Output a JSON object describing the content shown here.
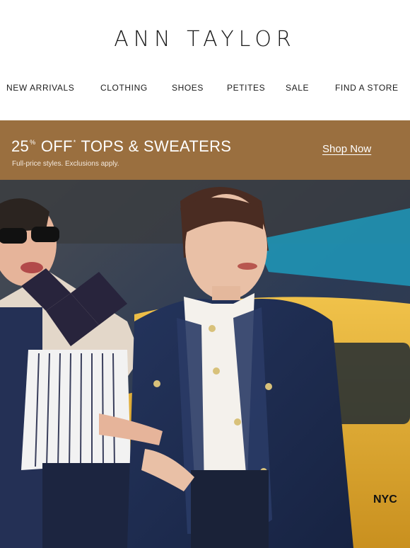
{
  "brand": {
    "name": "ANN TAYLOR"
  },
  "nav": {
    "items": [
      {
        "label": "NEW ARRIVALS"
      },
      {
        "label": "CLOTHING"
      },
      {
        "label": "SHOES"
      },
      {
        "label": "PETITES"
      },
      {
        "label": "SALE"
      },
      {
        "label": "FIND A STORE"
      }
    ]
  },
  "promo": {
    "percent": "25",
    "percent_sign": "%",
    "off": "OFF",
    "asterisk": "*",
    "category": "TOPS & SWEATERS",
    "subtext": "Full-price styles. Exclusions apply.",
    "cta": "Shop Now",
    "background": "#9a6f3f"
  },
  "hero": {
    "taxi_plate": "NYC",
    "colors": {
      "taxi": "#e8b23a",
      "jacket": "#1d2b4f",
      "shirt": "#f4f1ec"
    }
  }
}
